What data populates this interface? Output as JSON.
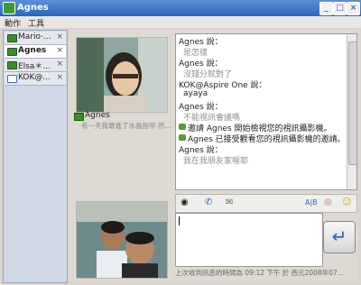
{
  "window": {
    "title": "Agnes",
    "minimize": "_",
    "maximize": "□",
    "close": "×"
  },
  "menu": [
    "動作",
    "工具"
  ],
  "tabs": [
    {
      "label": "Mario·...",
      "close": "×",
      "icon": "chat-icon"
    },
    {
      "label": "Agnes",
      "close": "×",
      "icon": "chat-icon",
      "active": true
    },
    {
      "label": "Elsa＊...",
      "close": "×",
      "icon": "chat-icon"
    },
    {
      "label": "KOK@...",
      "close": "×",
      "icon": "phone-icon"
    }
  ],
  "contact": {
    "name": "Agnes",
    "personal_message": "有一天我敢進了水晶指甲 然..."
  },
  "messages": [
    {
      "text": "Agnes 說：",
      "style": "normal"
    },
    {
      "text": "是怎樣",
      "style": "gray"
    },
    {
      "text": "Agnes 說：",
      "style": "normal"
    },
    {
      "text": "沒錢分就對了",
      "style": "gray"
    },
    {
      "text": "KOK@Aspire One 說：",
      "style": "normal"
    },
    {
      "text": "ayaya",
      "style": "normal"
    },
    {
      "text": "Agnes 說：",
      "style": "normal"
    },
    {
      "text": "不能視訊會議嗎",
      "style": "gray"
    },
    {
      "text": "邀請 Agnes 開始檢視您的視訊攝影機。",
      "style": "system"
    },
    {
      "text": "Agnes 已接受觀看您的視訊攝影機的邀請。",
      "style": "system"
    },
    {
      "text": "Agnes 說：",
      "style": "normal"
    },
    {
      "text": "我在我朋友家喔耶",
      "style": "gray"
    }
  ],
  "toolbar": {
    "font_label": "A|B",
    "emoticon_label": "☺"
  },
  "send": {
    "icon": "enter-icon"
  },
  "status": {
    "text": "上次收到訊息的時間為 09:12 下午 於 西元2008年07..."
  }
}
